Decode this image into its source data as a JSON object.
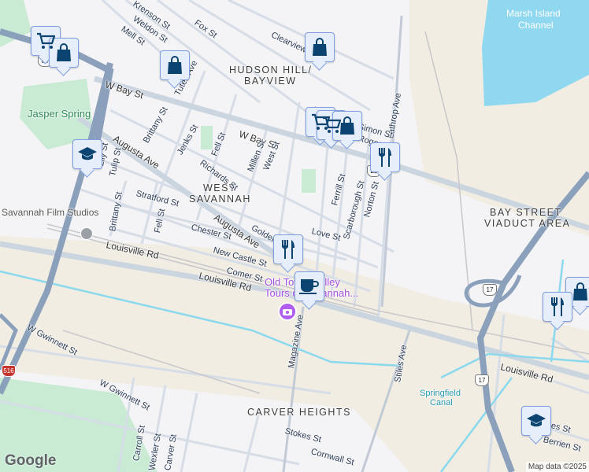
{
  "neighborhoods": {
    "hudson_hill": "HUDSON HILL/",
    "bayview": "BAYVIEW",
    "west": "WEST",
    "savannah": "SAVANNAH",
    "bay_street_viaduct": "BAY STREET",
    "viaduct_area": "VIADUCT AREA",
    "carver_heights": "CARVER HEIGHTS"
  },
  "water": {
    "marsh_island_1": "Marsh Island",
    "marsh_island_2": "Channel",
    "springfield_1": "Springfield",
    "springfield_2": "Canal"
  },
  "parks": {
    "jasper_spring": "Jasper Spring"
  },
  "poi": {
    "film_studios": "Savannah Film Studios",
    "trolley_1": "Old Town Trolley",
    "trolley_2": "Tours of Savannah..."
  },
  "streets": {
    "krenson": "Krenson St",
    "weldon": "Weldon St",
    "mell": "Mell St",
    "fox": "Fox St",
    "clearview": "Clearview",
    "tuten": "Tuten Ave",
    "w_bay_1": "W Bay St",
    "w_bay_2": "W Bay St",
    "brittany_1": "Brittany St",
    "brittany_2": "Brittany St",
    "jenks": "Jenks St",
    "fell_1": "Fell St",
    "fell_2": "Fell St",
    "richards": "Richards St",
    "millen": "Millen St",
    "west": "West St",
    "augusta_1": "Augusta Ave",
    "augusta_2": "Augusta Ave",
    "lily": "Lily St",
    "tulip": "Tulip St",
    "stratford": "Stratford St",
    "chester": "Chester St",
    "golden": "Golden",
    "love": "Love St",
    "new_castle": "New Castle St",
    "comer": "Comer St",
    "louisville_1": "Louisville Rd",
    "louisville_2": "Louisville Rd",
    "louisville_3": "Louisville Rd",
    "ferrill": "Ferrill St",
    "scarborough": "Scarborough St",
    "norton": "Norton St",
    "lathrop": "Lathrop Ave",
    "simon": "Simon St",
    "rogers": "Rogers St",
    "st_top": "St",
    "magazine": "Magazine Ave",
    "stiles": "Stiles Ave",
    "w_gwinnett_1": "W Gwinnett St",
    "w_gwinnett_2": "W Gwinnett St",
    "stokes": "Stokes St",
    "cornwall": "Cornwall St",
    "carroll": "Carroll St",
    "wexler": "Wexler St",
    "carver": "Carver St",
    "berrien": "Berrien St",
    "stes": "es St"
  },
  "shields": {
    "us17_a": "17",
    "us17_b": "17",
    "i516": "516",
    "us80": "80",
    "bay_shield": "25"
  },
  "markers": [
    "shopping-cart",
    "shopping-bag",
    "shopping-bag",
    "graduation-cap",
    "shopping-bag",
    "shopping-cart",
    "shopping-cart",
    "shopping-bag",
    "restaurant",
    "restaurant",
    "coffee",
    "restaurant",
    "shopping-bag",
    "graduation-cap"
  ],
  "footer": {
    "logo": "Google",
    "attribution": "Map data ©2025"
  }
}
